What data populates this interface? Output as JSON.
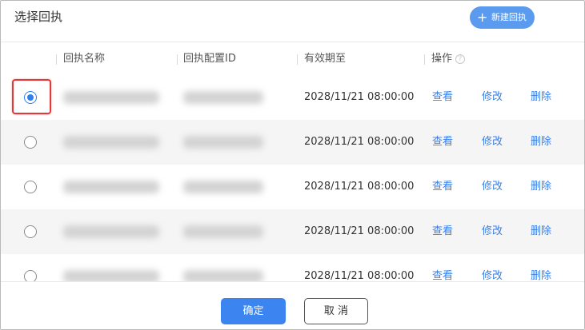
{
  "dialog": {
    "title": "选择回执",
    "new_button_icon": "plus-icon",
    "new_button_label": "新建回执"
  },
  "table": {
    "columns": {
      "name": "回执名称",
      "config_id": "回执配置ID",
      "expire": "有效期至",
      "actions": "操作"
    },
    "help_icon": "question-circle-icon",
    "rows": [
      {
        "selected": true,
        "name": "",
        "config_id": "",
        "expire": "2028/11/21 08:00:00",
        "view": "查看",
        "edit": "修改",
        "delete": "删除"
      },
      {
        "selected": false,
        "name": "",
        "config_id": "",
        "expire": "2028/11/21 08:00:00",
        "view": "查看",
        "edit": "修改",
        "delete": "删除"
      },
      {
        "selected": false,
        "name": "",
        "config_id": "",
        "expire": "2028/11/21 08:00:00",
        "view": "查看",
        "edit": "修改",
        "delete": "删除"
      },
      {
        "selected": false,
        "name": "",
        "config_id": "",
        "expire": "2028/11/21 08:00:00",
        "view": "查看",
        "edit": "修改",
        "delete": "删除"
      },
      {
        "selected": false,
        "name": "",
        "config_id": "",
        "expire": "2028/11/21 08:00:00",
        "view": "查看",
        "edit": "修改",
        "delete": "删除"
      }
    ]
  },
  "footer": {
    "confirm_label": "确定",
    "cancel_label": "取 消"
  },
  "colors": {
    "accent": "#3c84ef",
    "link": "#3a7fe6",
    "highlight": "#e23a3a",
    "stripe": "#f5f5f5"
  }
}
